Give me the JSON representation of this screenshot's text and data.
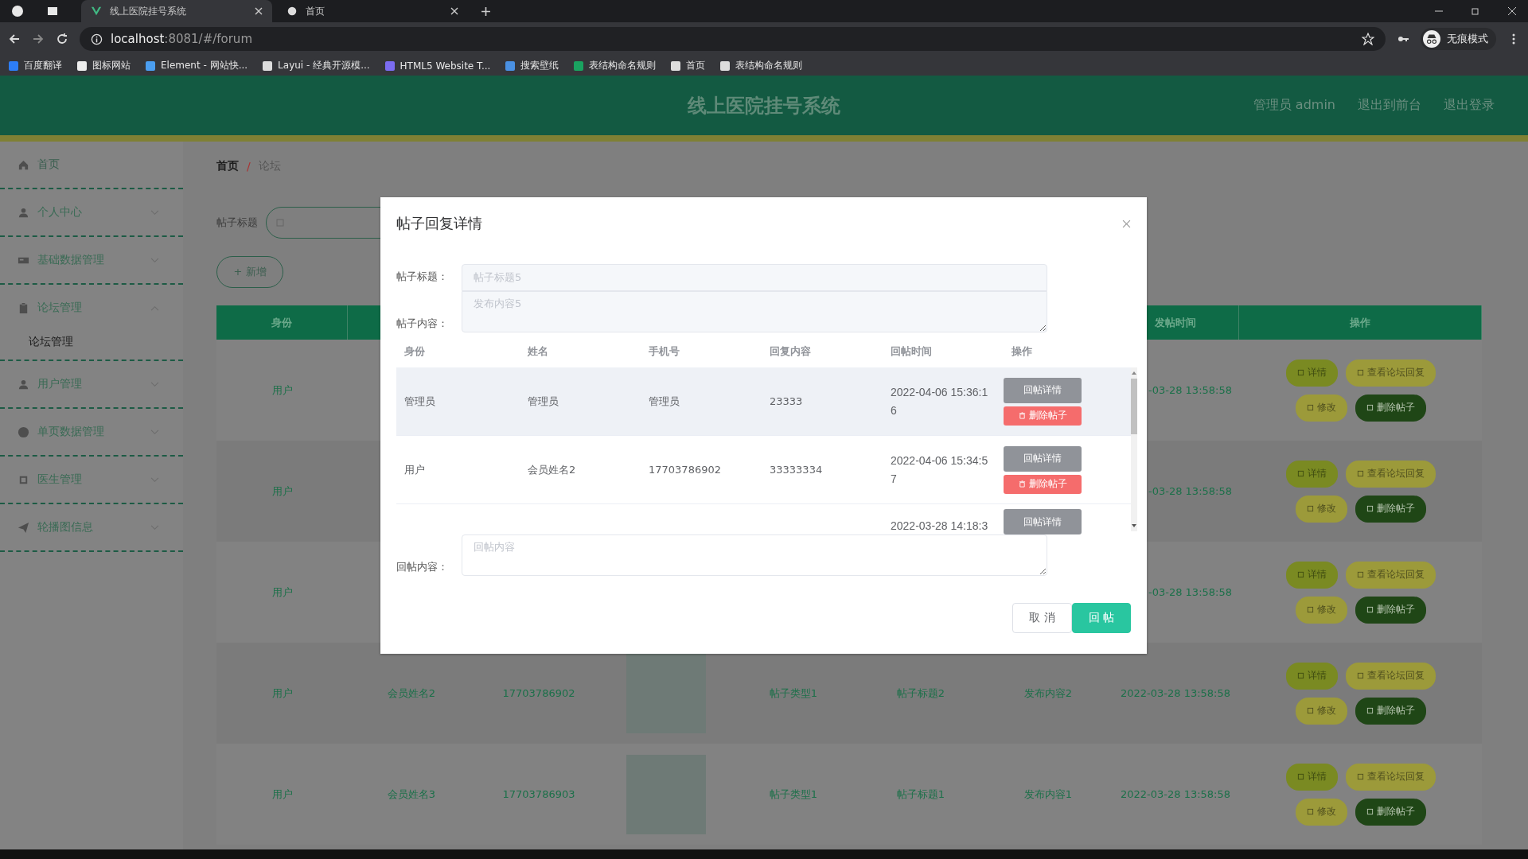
{
  "browser": {
    "tabs": [
      {
        "title": "线上医院挂号系统",
        "selected": true
      },
      {
        "title": "首页",
        "selected": false
      }
    ],
    "address_host": "localhost",
    "address_rest": ":8081/#/forum",
    "bookmarks": [
      "百度翻译",
      "图标网站",
      "Element - 网站快...",
      "Layui - 经典开源模...",
      "HTML5 Website T...",
      "搜索壁纸",
      "表结构命名规则",
      "首页",
      "表结构命名规则"
    ],
    "profile": "无痕模式"
  },
  "header": {
    "title": "线上医院挂号系统",
    "links": [
      "管理员 admin",
      "退出到前台",
      "退出登录"
    ]
  },
  "sidebar": {
    "items": [
      {
        "label": "首页",
        "kind": "link"
      },
      {
        "label": "个人中心",
        "kind": "menu",
        "expanded": false
      },
      {
        "label": "基础数据管理",
        "kind": "menu",
        "expanded": false
      },
      {
        "label": "论坛管理",
        "kind": "menu",
        "expanded": true,
        "children": [
          {
            "label": "论坛管理"
          }
        ]
      },
      {
        "label": "用户管理",
        "kind": "menu",
        "expanded": false
      },
      {
        "label": "单页数据管理",
        "kind": "menu",
        "expanded": false
      },
      {
        "label": "医生管理",
        "kind": "menu",
        "expanded": false
      },
      {
        "label": "轮播图信息",
        "kind": "menu",
        "expanded": false
      }
    ]
  },
  "breadcrumb": [
    "首页",
    "论坛"
  ],
  "breadcrumb_separator": "/",
  "search": {
    "label": "帖子标题"
  },
  "add_button": "+ 新增",
  "table": {
    "header": {
      "identity": "身份",
      "time": "发帖时间",
      "actions": "操作"
    },
    "rows": [
      {
        "identity": "用户",
        "time": "-03-28 13:58:58",
        "actions": [
          {
            "label": "详情",
            "kind": "detail"
          },
          {
            "label": "查看论坛回复",
            "kind": "replies"
          },
          {
            "label": "修改",
            "kind": "edit"
          },
          {
            "label": "删除帖子",
            "kind": "delete"
          }
        ]
      },
      {
        "identity": "用户",
        "time": "-03-28 13:58:58",
        "actions": [
          {
            "label": "详情",
            "kind": "detail"
          },
          {
            "label": "查看论坛回复",
            "kind": "replies"
          },
          {
            "label": "修改",
            "kind": "edit"
          },
          {
            "label": "删除帖子",
            "kind": "delete"
          }
        ]
      },
      {
        "identity": "用户",
        "time": "-03-28 13:58:58",
        "actions": [
          {
            "label": "详情",
            "kind": "detail"
          },
          {
            "label": "查看论坛回复",
            "kind": "replies"
          },
          {
            "label": "修改",
            "kind": "edit"
          },
          {
            "label": "删除帖子",
            "kind": "delete"
          }
        ]
      },
      {
        "identity": "用户",
        "name": "会员姓名2",
        "phone": "17703786902",
        "photo": true,
        "type": "帖子类型1",
        "title": "帖子标题2",
        "content": "发布内容2",
        "time": "2022-03-28 13:58:58",
        "actions": [
          {
            "label": "详情",
            "kind": "detail"
          },
          {
            "label": "查看论坛回复",
            "kind": "replies"
          },
          {
            "label": "修改",
            "kind": "edit"
          },
          {
            "label": "删除帖子",
            "kind": "delete"
          }
        ]
      },
      {
        "identity": "用户",
        "name": "会员姓名3",
        "phone": "17703786903",
        "photo": true,
        "type": "帖子类型1",
        "title": "帖子标题1",
        "content": "发布内容1",
        "time": "2022-03-28 13:58:58",
        "actions": [
          {
            "label": "详情",
            "kind": "detail"
          },
          {
            "label": "查看论坛回复",
            "kind": "replies"
          },
          {
            "label": "修改",
            "kind": "edit"
          },
          {
            "label": "删除帖子",
            "kind": "delete"
          }
        ]
      }
    ]
  },
  "dialog": {
    "title": "帖子回复详情",
    "fields": [
      {
        "label": "帖子标题：",
        "value": "帖子标题5",
        "kind": "input"
      },
      {
        "label": "帖子内容：",
        "value": "发布内容5",
        "kind": "textarea"
      }
    ],
    "table": {
      "columns": [
        "身份",
        "姓名",
        "手机号",
        "回复内容",
        "回帖时间",
        "操作"
      ],
      "rows": [
        {
          "identity": "管理员",
          "name": "管理员",
          "phone": "管理员",
          "reply": "23333",
          "time": "2022-04-06 15:36:16",
          "selected": true,
          "actions": [
            {
              "label": "回帖详情",
              "kind": "detail"
            },
            {
              "label": "删除帖子",
              "kind": "delete"
            }
          ]
        },
        {
          "identity": "用户",
          "name": "会员姓名2",
          "phone": "17703786902",
          "reply": "33333334",
          "time": "2022-04-06 15:34:57",
          "selected": false,
          "actions": [
            {
              "label": "回帖详情",
              "kind": "detail"
            },
            {
              "label": "删除帖子",
              "kind": "delete"
            }
          ]
        },
        {
          "time": "2022-03-28 14:18:3",
          "selected": false,
          "actions": [
            {
              "label": "回帖详情",
              "kind": "detail"
            }
          ]
        }
      ]
    },
    "reply": {
      "label": "回帖内容：",
      "placeholder": "回帖内容"
    },
    "buttons": [
      {
        "label": "取 消",
        "kind": "cancel"
      },
      {
        "label": "回 帖",
        "kind": "primary"
      }
    ]
  }
}
